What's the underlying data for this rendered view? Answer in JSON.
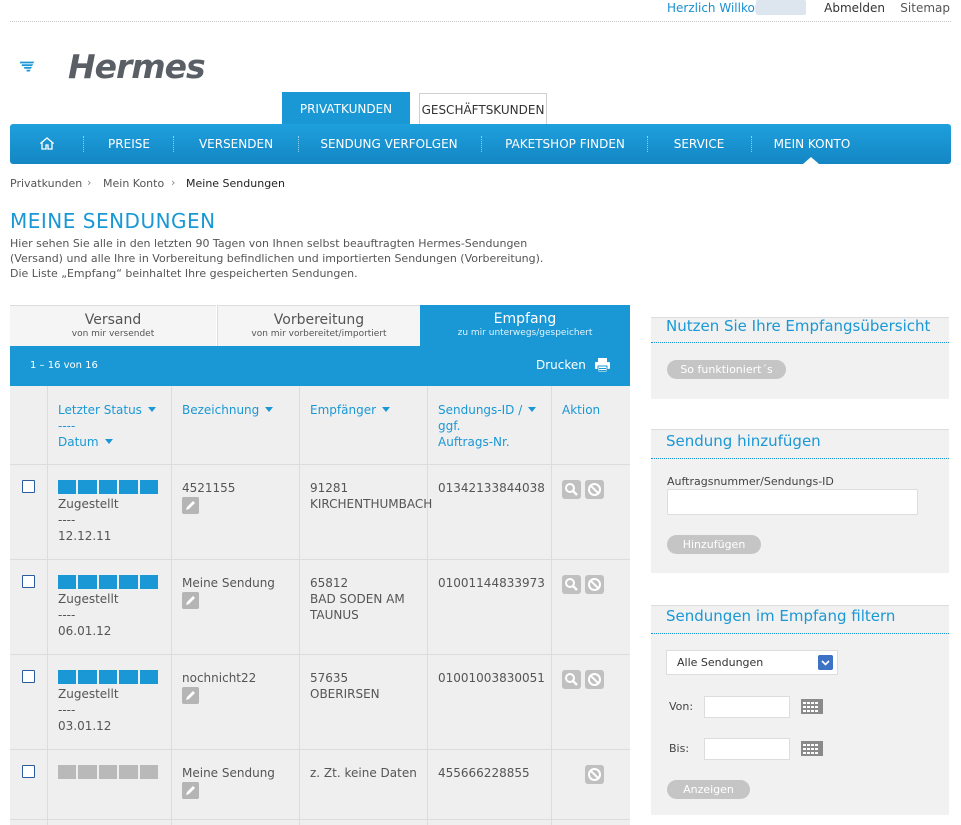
{
  "top": {
    "welcome": "Herzlich Willkommen,",
    "logout": "Abmelden",
    "sitemap": "Sitemap"
  },
  "logo": {
    "text": "Hermes"
  },
  "segments": {
    "private": "PRIVATKUNDEN",
    "business": "GESCHÄFTSKUNDEN"
  },
  "nav": {
    "items": [
      "PREISE",
      "VERSENDEN",
      "SENDUNG VERFOLGEN",
      "PAKETSHOP FINDEN",
      "SERVICE",
      "MEIN KONTO"
    ],
    "home_icon": "home-icon"
  },
  "breadcrumb": [
    "Privatkunden",
    "Mein Konto",
    "Meine Sendungen"
  ],
  "page": {
    "title": "MEINE SENDUNGEN",
    "intro_1": "Hier sehen Sie alle in den letzten 90 Tagen von Ihnen selbst beauftragten Hermes-Sendungen",
    "intro_2": "(Versand) und alle Ihre in Vorbereitung befindlichen und importierten Sendungen (Vorbereitung).",
    "intro_3": "Die Liste „Empfang“ beinhaltet Ihre gespeicherten Sendungen."
  },
  "tabs": [
    {
      "title": "Versand",
      "sub": "von mir versendet"
    },
    {
      "title": "Vorbereitung",
      "sub": "von mir vorbereitet/importiert"
    },
    {
      "title": "Empfang",
      "sub": "zu mir unterwegs/gespeichert"
    }
  ],
  "toolbar": {
    "count": "1 – 16 von 16",
    "print": "Drucken"
  },
  "table": {
    "headers": {
      "status": "Letzter Status",
      "dash": "----",
      "date": "Datum",
      "name": "Bezeichnung",
      "recipient": "Empfänger",
      "id1": "Sendungs-ID /",
      "id2": "ggf.",
      "id3": "Auftrags-Nr.",
      "action": "Aktion"
    },
    "rows": [
      {
        "status": "Zugestellt",
        "dash": "----",
        "date": "12.12.11",
        "name": "4521155",
        "recipient_1": "91281",
        "recipient_2": "KIRCHENTHUMBACH",
        "id": "01342133844038",
        "bars": "blue"
      },
      {
        "status": "Zugestellt",
        "dash": "----",
        "date": "06.01.12",
        "name": "Meine Sendung",
        "recipient_1": "65812",
        "recipient_2": "BAD SODEN AM",
        "recipient_3": "TAUNUS",
        "id": "01001144833973",
        "bars": "blue"
      },
      {
        "status": "Zugestellt",
        "dash": "----",
        "date": "03.01.12",
        "name": "nochnicht22",
        "recipient_1": "57635",
        "recipient_2": "OBERIRSEN",
        "id": "01001003830051",
        "bars": "blue"
      },
      {
        "name": "Meine Sendung",
        "recipient_1": "z. Zt. keine Daten",
        "id": "455666228855",
        "bars": "grey"
      }
    ]
  },
  "side": {
    "overview": {
      "title": "Nutzen Sie Ihre Empfangsübersicht",
      "button": "So funktioniert´s"
    },
    "add": {
      "title": "Sendung hinzufügen",
      "label": "Auftragsnummer/Sendungs-ID",
      "value": "",
      "button": "Hinzufügen"
    },
    "filter": {
      "title": "Sendungen im Empfang filtern",
      "select": "Alle Sendungen",
      "from": "Von:",
      "to": "Bis:",
      "button": "Anzeigen"
    }
  }
}
